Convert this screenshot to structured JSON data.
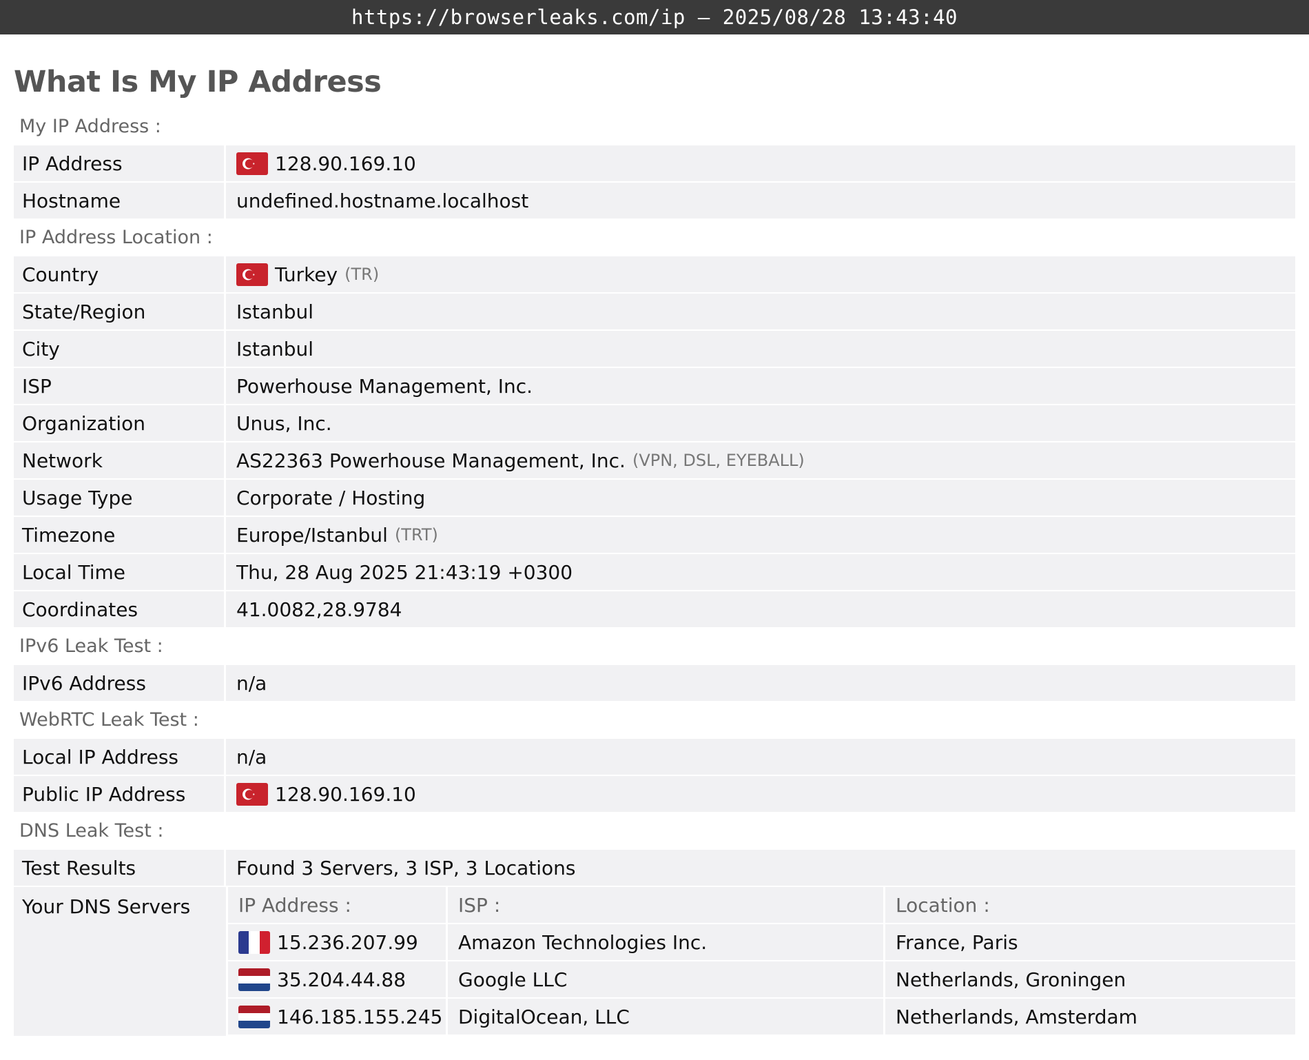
{
  "browser_bar": {
    "url_text": "https://browserleaks.com/ip – 2025/08/28 13:43:40"
  },
  "page": {
    "title": "What Is My IP Address"
  },
  "sections": {
    "my_ip": {
      "title": "My IP Address :",
      "ip_address": {
        "label": "IP Address",
        "value": "128.90.169.10"
      },
      "hostname": {
        "label": "Hostname",
        "value": "undefined.hostname.localhost"
      }
    },
    "location": {
      "title": "IP Address Location :",
      "country": {
        "label": "Country",
        "value": "Turkey",
        "code": "(TR)"
      },
      "region": {
        "label": "State/Region",
        "value": "Istanbul"
      },
      "city": {
        "label": "City",
        "value": "Istanbul"
      },
      "isp": {
        "label": "ISP",
        "value": "Powerhouse Management, Inc."
      },
      "organization": {
        "label": "Organization",
        "value": "Unus, Inc."
      },
      "network": {
        "label": "Network",
        "value": "AS22363 Powerhouse Management, Inc.",
        "tags": "(VPN, DSL, EYEBALL)"
      },
      "usage_type": {
        "label": "Usage Type",
        "value": "Corporate / Hosting"
      },
      "timezone": {
        "label": "Timezone",
        "value": "Europe/Istanbul",
        "abbr": "(TRT)"
      },
      "local_time": {
        "label": "Local Time",
        "value": "Thu, 28 Aug 2025 21:43:19 +0300"
      },
      "coordinates": {
        "label": "Coordinates",
        "value": "41.0082,28.9784"
      }
    },
    "ipv6": {
      "title": "IPv6 Leak Test :",
      "address": {
        "label": "IPv6 Address",
        "value": "n/a"
      }
    },
    "webrtc": {
      "title": "WebRTC Leak Test :",
      "local": {
        "label": "Local IP Address",
        "value": "n/a"
      },
      "public": {
        "label": "Public IP Address",
        "value": "128.90.169.10"
      }
    },
    "dns": {
      "title": "DNS Leak Test :",
      "results": {
        "label": "Test Results",
        "value": "Found 3 Servers, 3 ISP, 3 Locations"
      },
      "servers_label": "Your DNS Servers",
      "columns": [
        "IP Address :",
        "ISP :",
        "Location :"
      ],
      "servers": [
        {
          "flag": "france-flag-icon",
          "ip": "15.236.207.99",
          "isp": "Amazon Technologies Inc.",
          "location": "France, Paris"
        },
        {
          "flag": "netherlands-flag-icon",
          "ip": "35.204.44.88",
          "isp": "Google LLC",
          "location": "Netherlands, Groningen"
        },
        {
          "flag": "netherlands-flag-icon",
          "ip": "146.185.155.245",
          "isp": "DigitalOcean, LLC",
          "location": "Netherlands, Amsterdam"
        }
      ]
    }
  },
  "colors": {
    "topbar_bg": "#3a3a3a",
    "row_bg": "#f1f1f3",
    "section_title": "#666666",
    "turkey_flag_red": "#c8232c",
    "france_blue": "#2b3a8f",
    "netherlands_red": "#ae1c28",
    "netherlands_blue": "#21468b"
  }
}
